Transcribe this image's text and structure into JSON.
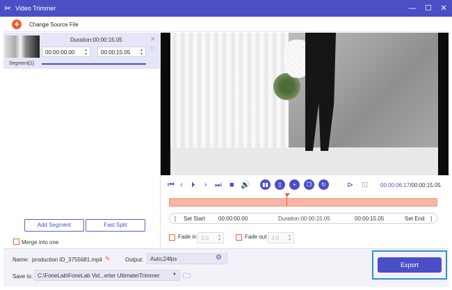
{
  "window": {
    "title": "Video Trimmer",
    "minimize": "—",
    "maximize": "☐",
    "close": "✕"
  },
  "header": {
    "change_source": "Change Source File"
  },
  "segment": {
    "label": "Segment[1]",
    "duration": "Duration:00:00:15.05",
    "start": "00:00:00.00",
    "end": "00:00:15.05"
  },
  "left": {
    "add_segment": "Add Segment",
    "fast_split": "Fast Split",
    "merge": "Merge into one"
  },
  "player": {
    "current": "00:00:06.17",
    "total": "/00:00:15.05"
  },
  "trim": {
    "set_start": "Set Start",
    "start": "00:00:00.00",
    "duration": "Duration:00:00:15.05",
    "end": "00:00:15.05",
    "set_end": "Set End"
  },
  "fade": {
    "fade_in": "Fade in",
    "fade_in_val": "3.0",
    "fade_out": "Fade out",
    "fade_out_val": "3.0"
  },
  "output": {
    "name_label": "Name:",
    "name": "production ID_3755681.mp4",
    "output_label": "Output:",
    "output": "Auto;24fps",
    "save_label": "Save to:",
    "save_path": "C:\\FoneLab\\FoneLab Vid...erter Ultimate\\Trimmer",
    "export": "Export"
  },
  "colors": {
    "accent": "#4b4fc6",
    "orange": "#f25c2b",
    "timeline": "#f6b5a6",
    "export_outline": "#2f8fd1"
  }
}
